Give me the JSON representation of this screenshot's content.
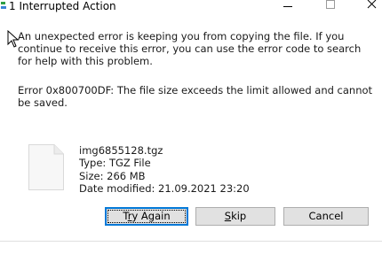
{
  "window": {
    "title": "1 Interrupted Action"
  },
  "message": {
    "main": "An unexpected error is keeping you from copying the file. If you continue to receive this error, you can use the error code to search for help with this problem.",
    "error": "Error 0x800700DF: The file size exceeds the limit allowed and cannot be saved."
  },
  "file": {
    "name": "img6855128.tgz",
    "type": "Type: TGZ File",
    "size": "Size: 266 MB",
    "modified": "Date modified: 21.09.2021 23:20",
    "icon": "generic-file-icon"
  },
  "buttons": {
    "try_again_prefix": "T",
    "try_again_mnemonic": "r",
    "try_again_suffix": "y Again",
    "skip_prefix": "",
    "skip_mnemonic": "S",
    "skip_suffix": "kip",
    "cancel": "Cancel"
  },
  "colors": {
    "focus_border": "#0078d7",
    "button_face": "#e1e1e1"
  }
}
